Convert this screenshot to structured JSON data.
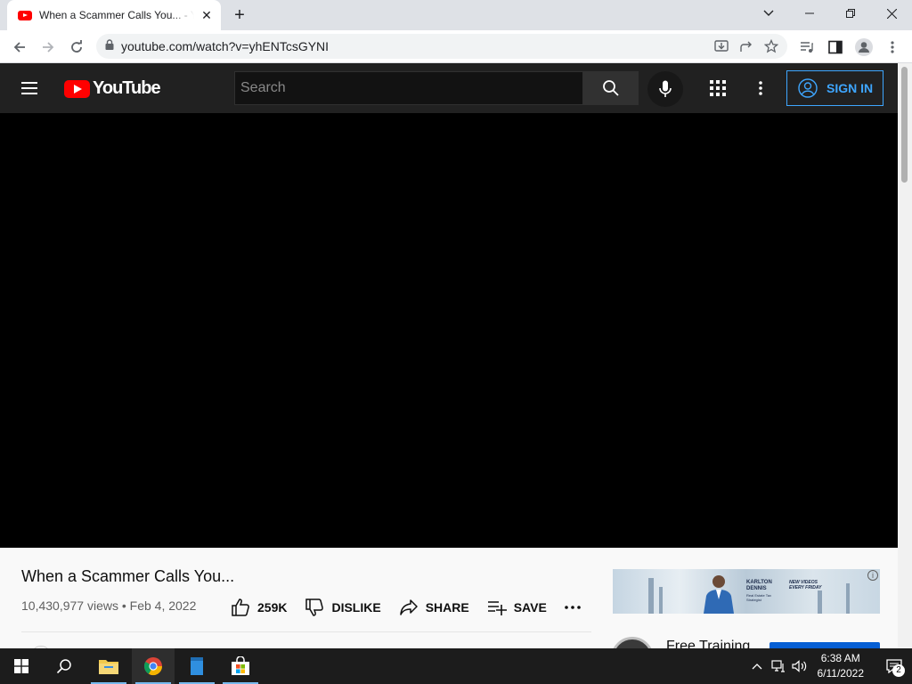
{
  "browser": {
    "tab": {
      "title": "When a Scammer Calls You... - YouTube"
    },
    "url": "youtube.com/watch?v=yhENTcsGYNI"
  },
  "youtube": {
    "logo_text": "YouTube",
    "search_placeholder": "Search",
    "sign_in_label": "SIGN IN",
    "accent_color": "#3ea6ff",
    "brand_color": "#ff0000"
  },
  "video": {
    "title": "When a Scammer Calls You...",
    "views": "10,430,977 views",
    "separator": "•",
    "date": "Feb 4, 2022",
    "actions": {
      "like_count": "259K",
      "dislike_label": "DISLIKE",
      "share_label": "SHARE",
      "save_label": "SAVE"
    }
  },
  "sidebar": {
    "ad": {
      "name_line": "KARLTON DENNIS",
      "subtitle_line": "Real Estate Tax Strategist",
      "promo_line": "NEW VIDEOS EVERY FRIDAY",
      "info_glyph": "i"
    },
    "recommendation": {
      "title": "Free Training"
    }
  },
  "taskbar": {
    "time": "6:38 AM",
    "date": "6/11/2022",
    "notification_count": "2"
  }
}
